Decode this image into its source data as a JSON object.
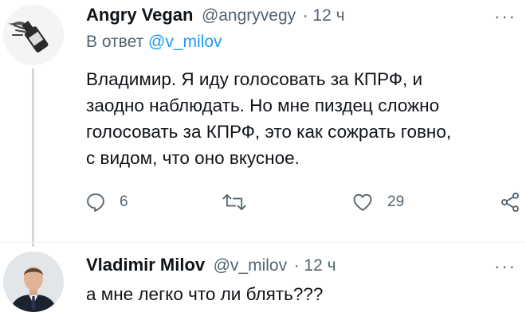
{
  "tweet1": {
    "name": "Angry Vegan",
    "handle": "@angryvegy",
    "time": "· 12 ч",
    "reply_prefix": "В ответ",
    "reply_handle": "@v_milov",
    "lines": [
      "Владимир. Я иду голосовать за КПРФ, и",
      "заодно наблюдать. Но мне пиздец сложно",
      "голосовать за КПРФ, это как сожрать говно,",
      "с видом, что оно вкусное."
    ],
    "replies": "6",
    "likes": "29"
  },
  "tweet2": {
    "name": "Vladimir Milov",
    "handle": "@v_milov",
    "time": "· 12 ч",
    "text": "а мне легко что ли блять???"
  },
  "more_label": "···"
}
